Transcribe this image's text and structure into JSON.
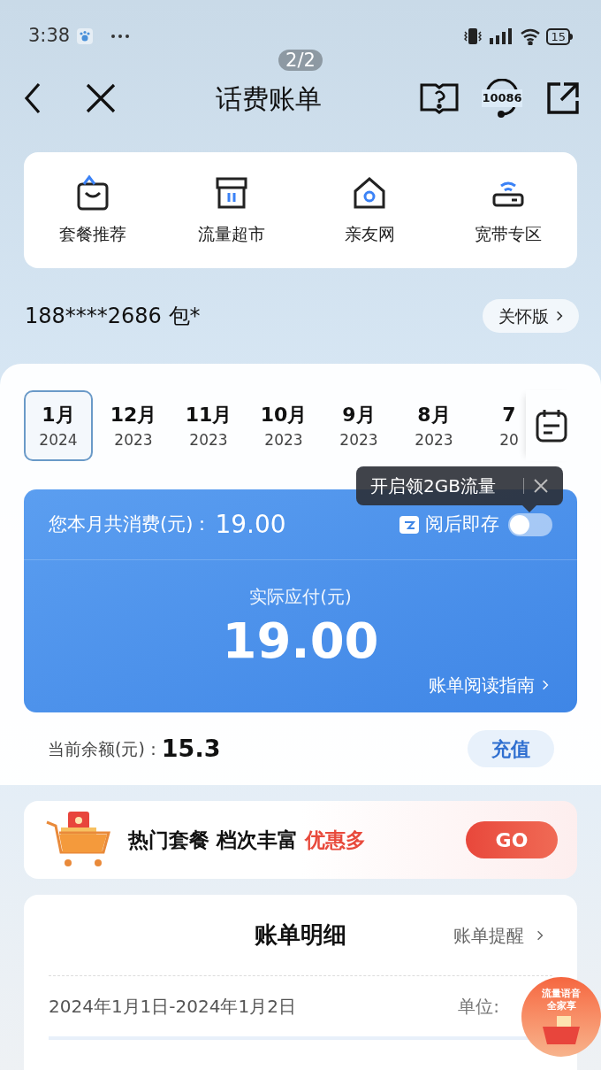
{
  "status_bar": {
    "time": "3:38",
    "battery": "15"
  },
  "page_indicator": "2/2",
  "nav": {
    "title": "话费账单",
    "service_number": "10086"
  },
  "shortcuts": [
    {
      "label": "套餐推荐",
      "kind": "bag"
    },
    {
      "label": "流量超市",
      "kind": "shop"
    },
    {
      "label": "亲友网",
      "kind": "home"
    },
    {
      "label": "宽带专区",
      "kind": "router"
    }
  ],
  "account": {
    "phone": "188****2686 包*",
    "care_button": "关怀版"
  },
  "months": [
    {
      "month": "1月",
      "year": "2024",
      "selected": true
    },
    {
      "month": "12月",
      "year": "2023",
      "selected": false
    },
    {
      "month": "11月",
      "year": "2023",
      "selected": false
    },
    {
      "month": "10月",
      "year": "2023",
      "selected": false
    },
    {
      "month": "9月",
      "year": "2023",
      "selected": false
    },
    {
      "month": "8月",
      "year": "2023",
      "selected": false
    },
    {
      "month": "7",
      "year": "20",
      "selected": false
    }
  ],
  "tooltip": "开启领2GB流量",
  "bill": {
    "total_label": "您本月共消费(元)：",
    "total": "19.00",
    "save_label": "阅后即存",
    "save_on": false,
    "payable_label": "实际应付(元)",
    "payable": "19.00",
    "guide_link": "账单阅读指南"
  },
  "balance": {
    "label": "当前余额(元)：",
    "value": "15.3",
    "button": "充值"
  },
  "promo": {
    "headline": "热门套餐 档次丰富",
    "highlight": "优惠多",
    "button": "GO"
  },
  "detail": {
    "title": "账单明细",
    "reminder": "账单提醒",
    "period": "2024年1月1日-2024年1月2日",
    "unit_label": "单位:"
  },
  "floating_badge": [
    "流量语音",
    "全家享"
  ]
}
